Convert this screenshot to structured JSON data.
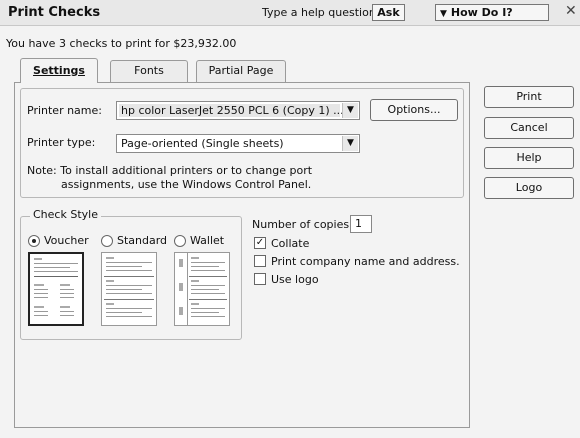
{
  "window": {
    "title": "Print Checks",
    "help_label": "Type a help question",
    "ask_label": "Ask",
    "how_do_i_label": "How Do I?",
    "close_glyph": "✕"
  },
  "summary": "You have 3 checks to print for $23,932.00",
  "tabs": [
    {
      "label": "Settings",
      "mnemonic": "S",
      "active": true
    },
    {
      "label": "Fonts",
      "mnemonic": "F",
      "active": false
    },
    {
      "label": "Partial Page",
      "mnemonic": "P",
      "active": false
    }
  ],
  "printer": {
    "name_label": "Printer name:",
    "name_value": "hp color LaserJet 2550 PCL 6 (Copy 1) ...",
    "options_label": "Options...",
    "type_label": "Printer type:",
    "type_value": "Page-oriented (Single sheets)",
    "note_line1": "Note: To install additional printers or to change port",
    "note_line2": "assignments, use the Windows Control Panel."
  },
  "check_style": {
    "title": "Check Style",
    "options": [
      {
        "label": "Voucher",
        "selected": true
      },
      {
        "label": "Standard",
        "selected": false
      },
      {
        "label": "Wallet",
        "selected": false
      }
    ]
  },
  "options": {
    "copies_label": "Number of copies:",
    "copies_value": "1",
    "collate_label": "Collate",
    "collate_checked": true,
    "print_company_label": "Print company name and address.",
    "print_company_checked": false,
    "use_logo_label": "Use logo",
    "use_logo_checked": false
  },
  "side_buttons": {
    "print": "Print",
    "cancel": "Cancel",
    "help": "Help",
    "logo": "Logo"
  }
}
